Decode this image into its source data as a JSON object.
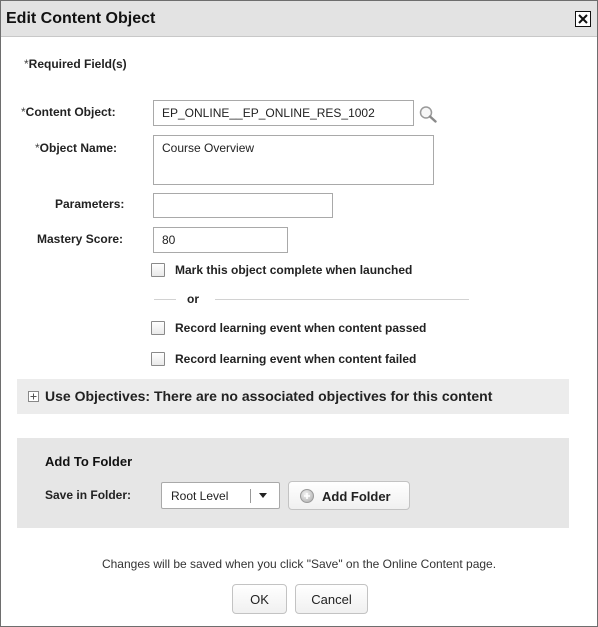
{
  "dialog": {
    "title": "Edit Content Object",
    "close_icon": "close-icon"
  },
  "form": {
    "required_marker": "*",
    "required_note": "Required Field(s)",
    "content_object": {
      "label": "Content Object:",
      "value": "EP_ONLINE__EP_ONLINE_RES_1002",
      "lookup_icon": "magnifier-icon"
    },
    "object_name": {
      "label": "Object Name:",
      "value": "Course Overview"
    },
    "parameters": {
      "label": "Parameters:",
      "value": ""
    },
    "mastery_score": {
      "label": "Mastery Score:",
      "value": "80"
    },
    "mark_complete": {
      "label": "Mark this object complete when launched",
      "checked": false
    },
    "or_text": "or",
    "record_passed": {
      "label": "Record learning event when content passed",
      "checked": false
    },
    "record_failed": {
      "label": "Record learning event when content failed",
      "checked": false
    }
  },
  "objectives": {
    "text": "Use Objectives: There are no associated objectives for this content",
    "expand_icon": "plus-box-icon"
  },
  "folder": {
    "title": "Add To Folder",
    "save_label": "Save in Folder:",
    "selected": "Root Level",
    "add_button": "Add Folder"
  },
  "footer": {
    "note": "Changes will be saved when you click \"Save\" on the Online Content page.",
    "ok": "OK",
    "cancel": "Cancel"
  },
  "colors": {
    "titlebar": "#e3e3e3",
    "panel": "#e6e6e6",
    "border": "#a9a9a9"
  }
}
